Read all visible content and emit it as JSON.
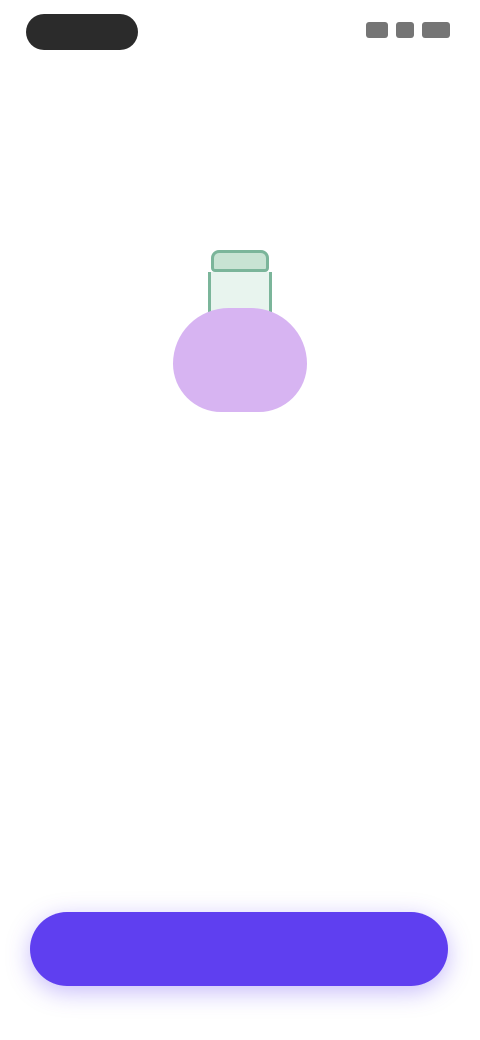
{
  "status_bar": {
    "signal_icon": "signal-icon",
    "wifi_icon": "wifi-icon",
    "battery_icon": "battery-icon"
  },
  "hero": {
    "illustration": "jar-icon",
    "jar_label": "",
    "title": "",
    "link_text": "",
    "description": ""
  },
  "primary_button": {
    "label": ""
  },
  "colors": {
    "accent": "#5f3ff0",
    "jar_body": "#d7b4f2",
    "jar_lid": "#7bb59a",
    "link": "#7a6af0"
  }
}
